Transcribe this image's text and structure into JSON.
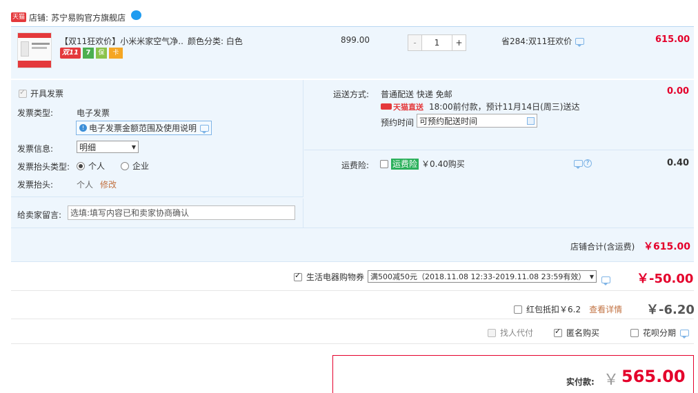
{
  "store": {
    "badge": "天猫",
    "label": "店铺:",
    "name": "苏宁易购官方旗舰店",
    "chat_icon": "chat-bubble-icon"
  },
  "item": {
    "title": "【双11狂欢价】小米米家空气净...",
    "spec": "颜色分类: 白色",
    "price": "899.00",
    "qty": "1",
    "minus": "-",
    "plus": "+",
    "discount": "省284:双11狂欢价",
    "subtotal": "615.00",
    "tags": [
      "双11",
      "7",
      "保",
      "卡"
    ]
  },
  "invoice": {
    "open_label": "开具发票",
    "type_label": "发票类型:",
    "type_value": "电子发票",
    "notice": "电子发票金额范围及使用说明",
    "info_label": "发票信息:",
    "info_value": "明细",
    "head_type_label": "发票抬头类型:",
    "option_personal": "个人",
    "option_company": "企业",
    "head_label": "发票抬头:",
    "head_value": "个人",
    "edit_link": "修改"
  },
  "delivery": {
    "label": "运送方式:",
    "method": "普通配送 快递 免邮",
    "tmall_direct": "天猫直送",
    "eta": "18:00前付款，预计11月14日(周三)送达",
    "reserve_label": "预约时间",
    "reserve_placeholder": "可预约配送时间",
    "fee": "0.00"
  },
  "insurance": {
    "label": "运费险:",
    "badge": "运费险",
    "text": "￥0.40购买",
    "fee": "0.40"
  },
  "message": {
    "label": "给卖家留言:",
    "placeholder": "选填:填写内容已和卖家协商确认"
  },
  "store_total": {
    "label": "店铺合计(含运费)",
    "value": "￥615.00"
  },
  "coupon": {
    "label": "生活电器购物券",
    "selected": "满500减50元（2018.11.08 12:33-2019.11.08 23:59有效）",
    "value": "￥-50.00"
  },
  "redpacket": {
    "label": "红包抵扣￥6.2",
    "link": "查看详情",
    "value": "￥-6.20"
  },
  "options": {
    "proxy_pay": "找人代付",
    "anonymous": "匿名购买",
    "installment": "花呗分期"
  },
  "final": {
    "label": "实付款:",
    "currency": "￥",
    "amount": "565.00"
  },
  "colors": {
    "accent_red": "#e4002b",
    "tmall_red": "#e4393c",
    "light_blue_bg": "#eef6fd",
    "link_orange": "#c27343",
    "insurance_green": "#2bb05b"
  }
}
